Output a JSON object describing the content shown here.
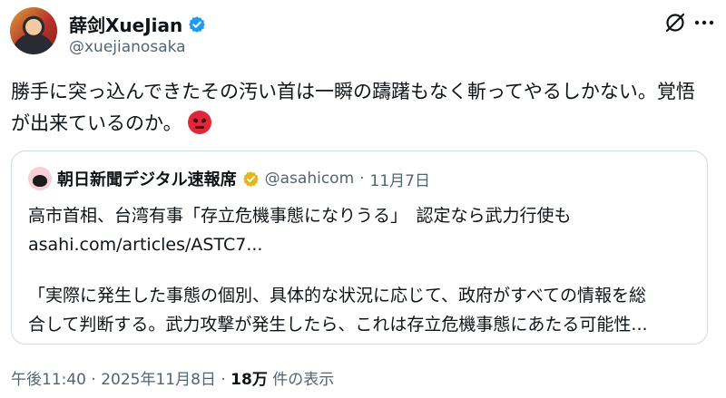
{
  "author": {
    "display_name": "薛剑XueJian",
    "handle": "@xuejianosaka",
    "verified_badge": "blue-check"
  },
  "tweet": {
    "text": "勝手に突っ込んできたその汚い首は一瞬の躊躇もなく斬ってやるしかない。覚悟が出来ているのか。",
    "emoji": "angry-face"
  },
  "quote": {
    "name": "朝日新聞デジタル速報席",
    "badge": "gold-check",
    "handle": "@asahicom",
    "separator": "·",
    "date": "11月7日",
    "headline": "高市首相、台湾有事「存立危機事態になりうる」　認定なら武力行使も",
    "link": "asahi.com/articles/ASTC7...",
    "excerpt_line1": "「実際に発生した事態の個別、具体的な状況に応じて、政府がすべての情報を総",
    "excerpt_line2": "合して判断する。武力攻撃が発生したら、これは存立危機事態にあたる可能性..."
  },
  "footer": {
    "time": "午後11:40",
    "separator": "·",
    "date": "2025年11月8日",
    "views_count": "18万",
    "views_label": "件の表示"
  },
  "actions": {
    "grok_icon": "grok-icon",
    "more_icon": "more-icon"
  },
  "colors": {
    "text": "#0f1419",
    "secondary": "#536471",
    "border": "#cfd9de",
    "blue_badge": "#1d9bf0",
    "gold_badge": "#e2b719"
  }
}
